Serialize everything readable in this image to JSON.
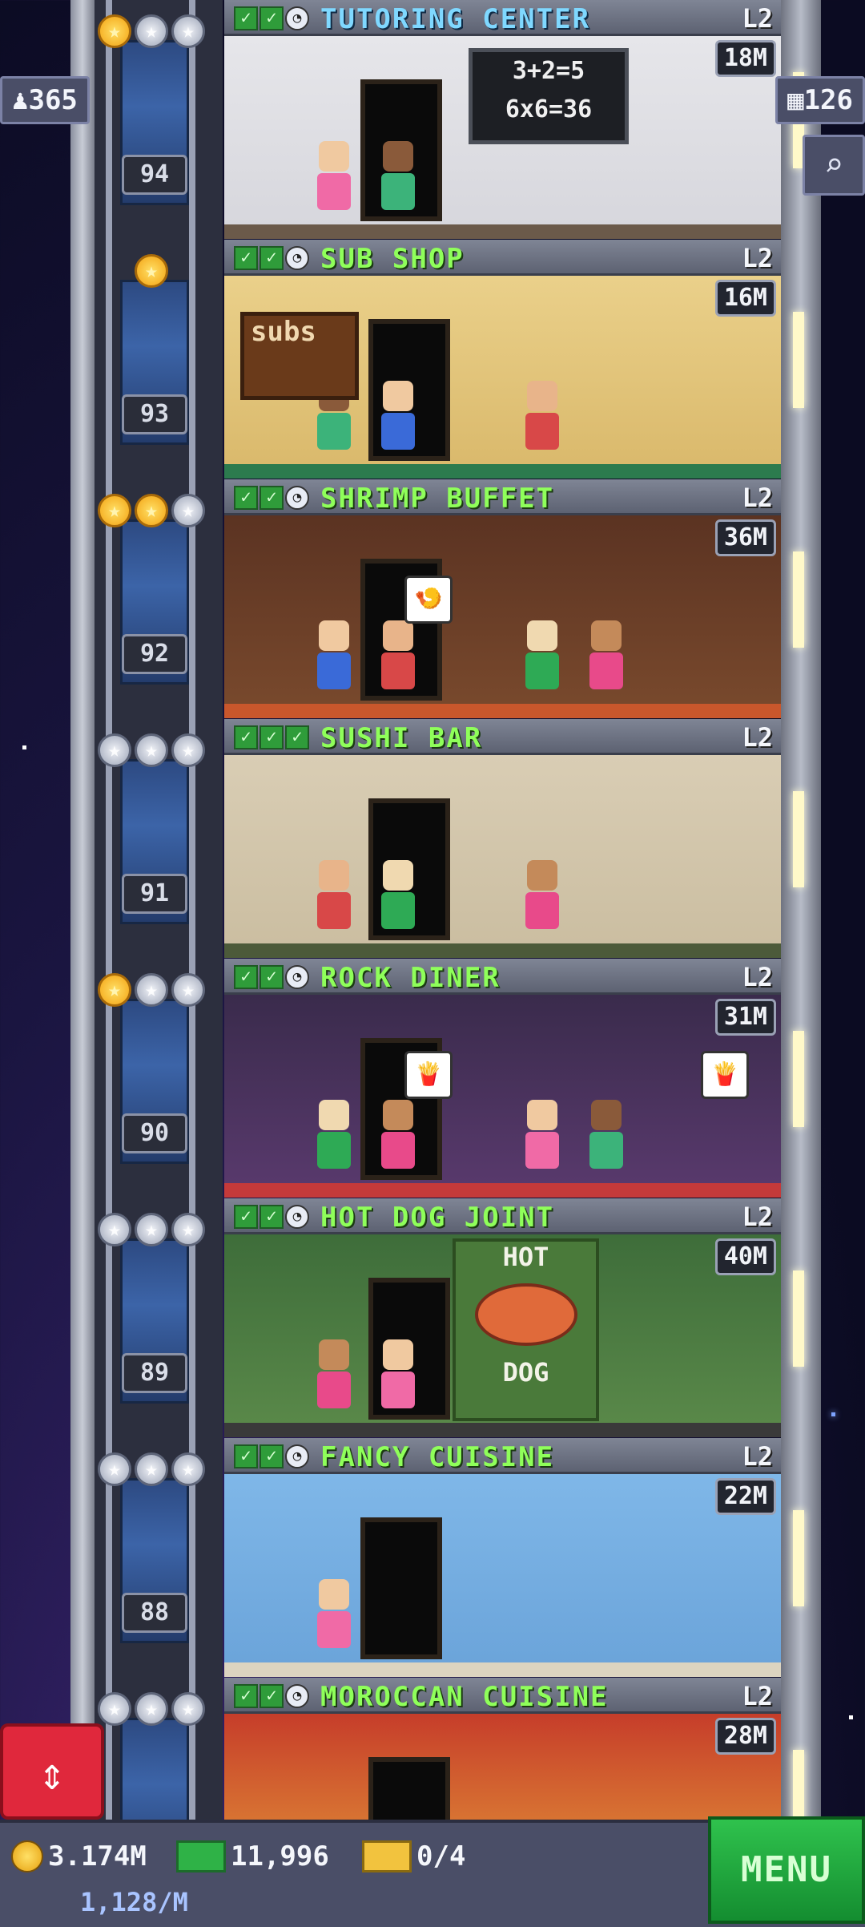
{
  "hud": {
    "population": "365",
    "floors": "126",
    "coins": "3.174M",
    "coin_rate": "1,128/M",
    "bux": "11,996",
    "tickets": "0/4",
    "menu_label": "MENU"
  },
  "icons": {
    "population": "person-icon",
    "floors": "building-icon",
    "zoom": "magnifier-icon",
    "elevator_toggle": "up-down-arrows-icon",
    "coin": "coin-icon",
    "bux": "tower-bux-icon",
    "ticket": "vip-ticket-icon"
  },
  "colors": {
    "floor_name_green": "#8fff5a",
    "floor_name_blue": "#7fd8ff",
    "menu_green": "#1fa93b",
    "elevator_toggle_red": "#e0283c"
  },
  "floors": [
    {
      "number": "",
      "name": "TUTORING CENTER",
      "level": "L2",
      "earnings": "18M",
      "stars": [
        "gold",
        "silver",
        "silver"
      ],
      "name_color": "blue"
    },
    {
      "number": "94",
      "name": "SUB SHOP",
      "level": "L2",
      "earnings": "16M",
      "stars": [
        "gold"
      ]
    },
    {
      "number": "93",
      "name": "SHRIMP BUFFET",
      "level": "L2",
      "earnings": "36M",
      "stars": [
        "gold",
        "gold",
        "silver"
      ]
    },
    {
      "number": "92",
      "name": "SUSHI BAR",
      "level": "L2",
      "earnings": "",
      "stars": [
        "silver",
        "silver",
        "silver"
      ]
    },
    {
      "number": "91",
      "name": "ROCK DINER",
      "level": "L2",
      "earnings": "31M",
      "stars": [
        "gold",
        "silver",
        "silver"
      ]
    },
    {
      "number": "90",
      "name": "HOT DOG JOINT",
      "level": "L2",
      "earnings": "40M",
      "stars": [
        "silver",
        "silver",
        "silver"
      ]
    },
    {
      "number": "89",
      "name": "FANCY CUISINE",
      "level": "L2",
      "earnings": "22M",
      "stars": [
        "silver",
        "silver",
        "silver"
      ]
    },
    {
      "number": "88",
      "name": "MOROCCAN CUISINE",
      "level": "L2",
      "earnings": "28M",
      "stars": [
        "silver",
        "silver",
        "silver"
      ]
    }
  ],
  "scene_text": {
    "tutoring_board_line1": "3+2=5",
    "tutoring_board_line2": "6x6=36",
    "sub_sign": "subs",
    "hot_dog_sign_top": "HOT",
    "hot_dog_sign_bottom": "DOG"
  }
}
